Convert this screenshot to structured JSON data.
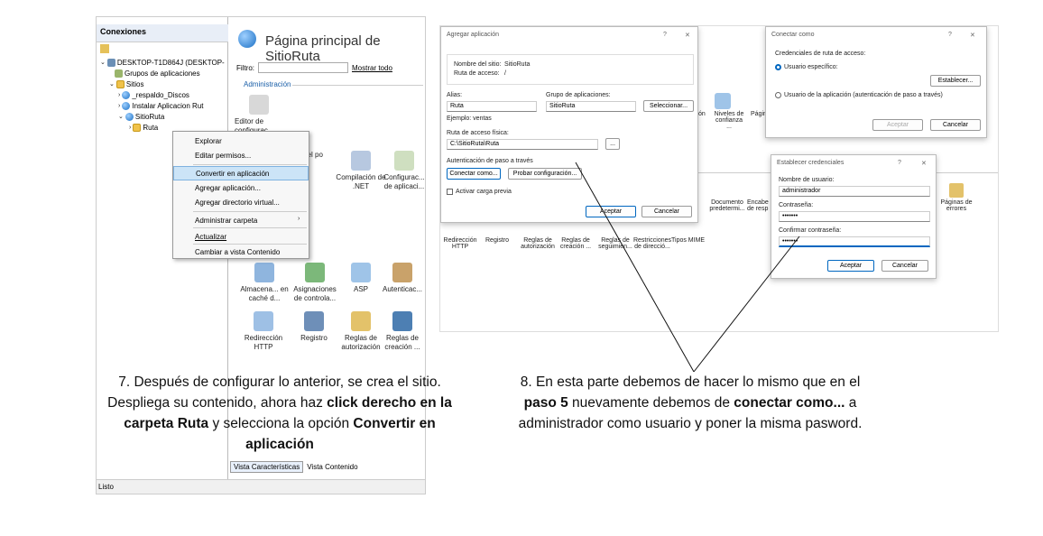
{
  "left": {
    "connections_label": "Conexiones",
    "tree": [
      "DESKTOP-T1D864J (DESKTOP-",
      "Grupos de aplicaciones",
      "Sitios",
      "_respaldo_Discos",
      "Instalar Aplicacion Rut",
      "SitioRuta",
      "Ruta"
    ],
    "main_title": "Página principal de SitioRuta",
    "filter_label": "Filtro:",
    "show_all": "Mostrar todo",
    "section_admin": "Administración",
    "editor_label": "Editor de configurac...",
    "features_top": [
      "del\npo",
      "Compilación de .NET",
      "Configurac... de aplicaci..."
    ],
    "features_row1": [
      "Almacena... en caché d...",
      "Asignaciones de controla...",
      "ASP",
      "Autenticac..."
    ],
    "features_row2": [
      "Redirección HTTP",
      "Registro",
      "Reglas de autorización",
      "Reglas de creación ..."
    ],
    "context_menu": [
      "Explorar",
      "Editar permisos...",
      "Convertir en aplicación",
      "Agregar aplicación...",
      "Agregar directorio virtual...",
      "Administrar carpeta",
      "Actualizar",
      "Cambiar a vista Contenido"
    ],
    "view_tab_features": "Vista Características",
    "view_tab_content": "Vista Contenido",
    "status": "Listo",
    "caption_parts": [
      "7. Después de configurar lo anterior, se crea el sitio. Despliega su contenido, ahora haz ",
      "click derecho en la carpeta Ruta",
      " y selecciona la opción ",
      "Convertir en aplicación"
    ]
  },
  "right": {
    "add_app": {
      "title": "Agregar aplicación",
      "site_name_label": "Nombre del sitio:",
      "site_name": "SitioRuta",
      "path_label": "Ruta de acceso:",
      "path": "/",
      "alias_label": "Alias:",
      "alias": "Ruta",
      "pool_label": "Grupo de aplicaciones:",
      "pool": "SitioRuta",
      "select_btn": "Seleccionar...",
      "example": "Ejemplo: ventas",
      "physical_label": "Ruta de acceso física:",
      "physical": "C:\\SitioRuta\\Ruta",
      "browse": "...",
      "auth_label": "Autenticación de paso a través",
      "connect_btn": "Conectar como...",
      "test_btn": "Probar configuración...",
      "preload": "Activar carga previa",
      "ok": "Aceptar",
      "cancel": "Cancelar"
    },
    "connect_as": {
      "title": "Conectar como",
      "creds_label": "Credenciales de ruta de acceso:",
      "specific_user": "Usuario específico:",
      "set_btn": "Establecer...",
      "app_user": "Usuario de la aplicación (autenticación de paso a través)",
      "ok": "Aceptar",
      "cancel": "Cancelar"
    },
    "set_creds": {
      "title": "Establecer credenciales",
      "user_label": "Nombre de usuario:",
      "user": "administrador",
      "pass_label": "Contraseña:",
      "pass": "•••••••",
      "confirm_label": "Confirmar contraseña:",
      "confirm": "•••••••",
      "ok": "Aceptar",
      "cancel": "Cancelar"
    },
    "bg_features": [
      "ón",
      "Niveles de confianza ...",
      "Págin errore",
      "Documento predetermi...",
      "Encabe de resp",
      "Páginas de errores"
    ],
    "bg_row": [
      "Redirección HTTP",
      "Registro",
      "Reglas de autorización",
      "Reglas de creación ...",
      "Reglas de seguimien...",
      "Restricciones de direcció...",
      "Tipos MIME"
    ],
    "caption_parts": [
      "8. En esta parte debemos de hacer lo mismo que en el ",
      "paso  5",
      " nuevamente debemos de ",
      "conectar como...",
      " a administrador como usuario y poner la misma pasword."
    ]
  }
}
